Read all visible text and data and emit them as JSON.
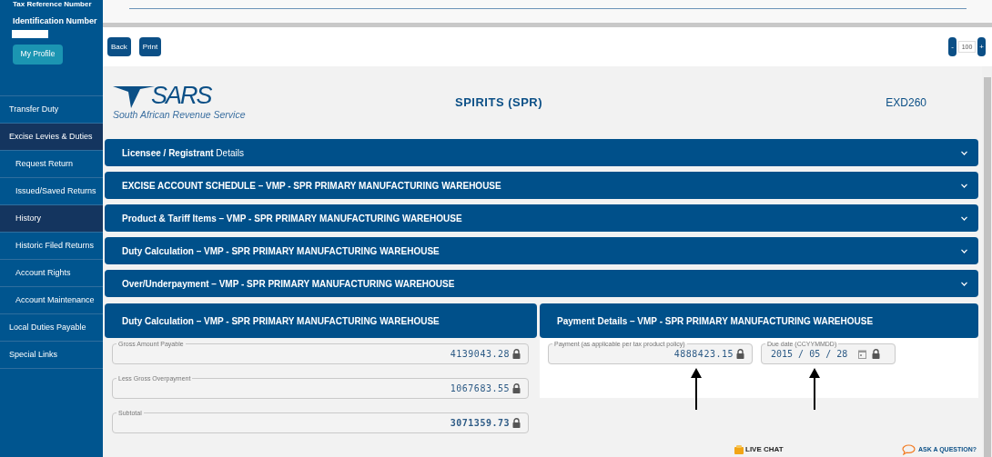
{
  "sidebar": {
    "profile": {
      "tax_reference_label": "Tax Reference Number",
      "identification_label": "Identification Number",
      "profile_button": "My Profile"
    },
    "items": [
      {
        "label": "Transfer Duty",
        "selected": false
      },
      {
        "label": "Excise Levies & Duties",
        "selected": true,
        "children": [
          {
            "label": "Request Return",
            "selected": false
          },
          {
            "label": "Issued/Saved Returns",
            "selected": false
          },
          {
            "label": "History",
            "selected": true
          },
          {
            "label": "Historic Filed Returns",
            "selected": false
          },
          {
            "label": "Account Rights",
            "selected": false
          },
          {
            "label": "Account Maintenance",
            "selected": false
          }
        ]
      },
      {
        "label": "Local Duties Payable",
        "selected": false
      },
      {
        "label": "Special Links",
        "selected": false
      }
    ]
  },
  "toolbar": {
    "buttons": [
      "Back",
      "Print"
    ],
    "zoom": {
      "decrease": "-",
      "value": "100",
      "increase": "+"
    }
  },
  "header": {
    "logo": {
      "wordmark": "SARS",
      "tagline": "South African Revenue Service"
    },
    "title": "SPIRITS (SPR)",
    "form_code": "EXD260"
  },
  "accordions": [
    {
      "title": "**Licensee / Registrant** Details",
      "expanded": false
    },
    {
      "title": "EXCISE ACCOUNT SCHEDULE – VMP - SPR PRIMARY MANUFACTURING WAREHOUSE",
      "expanded": false
    },
    {
      "title": "Product & Tariff Items – VMP - SPR PRIMARY MANUFACTURING WAREHOUSE",
      "expanded": false
    },
    {
      "title": "Duty Calculation – VMP - SPR PRIMARY MANUFACTURING WAREHOUSE",
      "expanded": false
    },
    {
      "title": "Over/Underpayment – VMP - SPR PRIMARY MANUFACTURING WAREHOUSE",
      "expanded": false
    }
  ],
  "duty_calculation": {
    "title": "Duty Calculation – VMP - SPR PRIMARY MANUFACTURING WAREHOUSE",
    "fields": [
      {
        "label": "Gross Amount Payable",
        "value": "4139043.28",
        "bold": false
      },
      {
        "label": "Less Gross Overpayment",
        "value": "1067683.55",
        "bold": false
      },
      {
        "label": "Subtotal",
        "value": "3071359.73",
        "bold": true
      }
    ]
  },
  "payment_details": {
    "title": "Payment Details – VMP - SPR PRIMARY MANUFACTURING WAREHOUSE",
    "payment": {
      "label": "Payment (as applicable per tax product policy)",
      "value": "4888423.15"
    },
    "due_date": {
      "label": "Due date (CCYYMMDD)",
      "year": "2015",
      "month": "05",
      "day": "28",
      "separator": "/"
    }
  },
  "footer": {
    "live_chat": "LIVE CHAT",
    "ask_question": "ASK A QUESTION?"
  }
}
